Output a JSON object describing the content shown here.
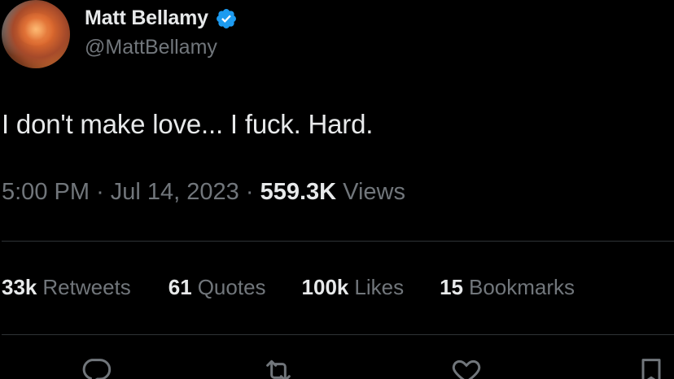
{
  "profile": {
    "display_name": "Matt Bellamy",
    "handle": "@MattBellamy",
    "verified": true
  },
  "tweet": {
    "text": "I don't make love... I fuck. Hard.",
    "time": "5:00 PM",
    "separator": "·",
    "date": "Jul 14, 2023",
    "views_count": "559.3K",
    "views_label": "Views"
  },
  "stats": {
    "retweets": {
      "count": "33k",
      "label": "Retweets"
    },
    "quotes": {
      "count": "61",
      "label": "Quotes"
    },
    "likes": {
      "count": "100k",
      "label": "Likes"
    },
    "bookmarks": {
      "count": "15",
      "label": "Bookmarks"
    }
  },
  "icons": {
    "verified": "verified-badge-icon",
    "reply": "reply-icon",
    "retweet": "retweet-icon",
    "like": "heart-icon",
    "bookmark": "bookmark-icon"
  },
  "colors": {
    "background": "#000000",
    "primary_text": "#e7e9ea",
    "secondary_text": "#71767b",
    "verified_blue": "#1d9bf0",
    "divider": "#2f3336"
  }
}
